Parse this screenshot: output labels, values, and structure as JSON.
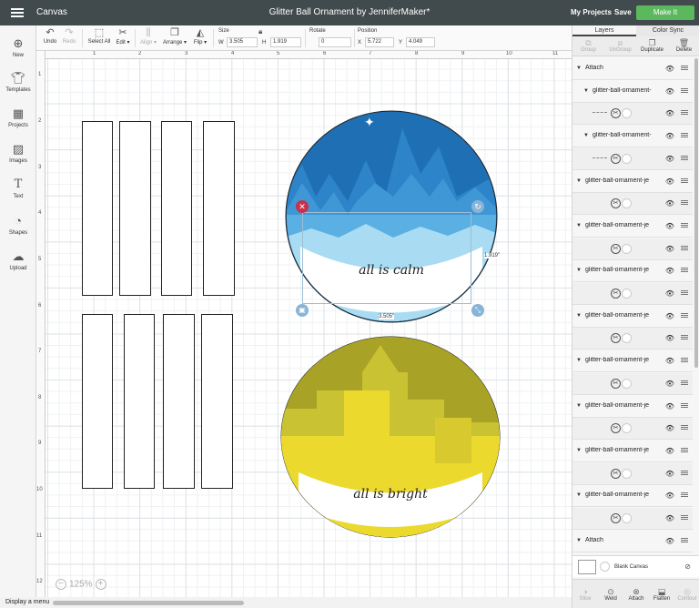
{
  "topbar": {
    "app_name": "Canvas",
    "doc_title": "Glitter Ball Ornament by JenniferMaker*",
    "my_projects": "My Projects",
    "save": "Save",
    "make_it": "Make It"
  },
  "toolbar": {
    "undo": "Undo",
    "redo": "Redo",
    "select_all": "Select All",
    "edit": "Edit",
    "align": "Align",
    "arrange": "Arrange",
    "flip": "Flip",
    "size_label": "Size",
    "w_label": "W",
    "w_value": "3.505",
    "h_label": "H",
    "h_value": "1.919",
    "rotate_label": "Rotate",
    "rotate_value": "0",
    "position_label": "Position",
    "x_label": "X",
    "x_value": "5.722",
    "y_label": "Y",
    "y_value": "4.049"
  },
  "sidebar": {
    "items": [
      {
        "label": "New",
        "icon": "plus-icon"
      },
      {
        "label": "Templates",
        "icon": "shirt-icon"
      },
      {
        "label": "Projects",
        "icon": "projects-icon"
      },
      {
        "label": "Images",
        "icon": "image-icon"
      },
      {
        "label": "Text",
        "icon": "text-icon"
      },
      {
        "label": "Shapes",
        "icon": "shapes-icon"
      },
      {
        "label": "Upload",
        "icon": "upload-icon"
      }
    ]
  },
  "canvas": {
    "ruler_top": [
      "1",
      "2",
      "3",
      "4",
      "5",
      "6",
      "7",
      "8",
      "9",
      "10",
      "11"
    ],
    "ruler_left": [
      "1",
      "2",
      "3",
      "4",
      "5",
      "6",
      "7",
      "8",
      "9",
      "10",
      "11",
      "12"
    ],
    "width_readout": "3.505\"",
    "height_readout": "1.919\"",
    "zoom": "125%",
    "ornament_top_text": "all is calm",
    "ornament_bottom_text": "all is bright",
    "colors": {
      "blue_dark": "#1f6fb5",
      "blue_mid": "#3f97d6",
      "blue_light": "#a9dcf2",
      "olive": "#a8a226",
      "olive_light": "#c9c232",
      "yellow": "#ecd92d"
    }
  },
  "status": {
    "text": "Display a menu"
  },
  "layers": {
    "tabs": [
      "Layers",
      "Color Sync"
    ],
    "actions": [
      "Group",
      "UnGroup",
      "Duplicate",
      "Delete"
    ],
    "rows": [
      {
        "type": "group",
        "name": "Attach",
        "indent": 0
      },
      {
        "type": "group",
        "name": "glitter-ball-ornament-",
        "indent": 1
      },
      {
        "type": "item",
        "thumb": true
      },
      {
        "type": "group",
        "name": "glitter-ball-ornament-",
        "indent": 1
      },
      {
        "type": "item",
        "thumb": true
      },
      {
        "type": "group",
        "name": "glitter-ball-ornament-je",
        "indent": 0
      },
      {
        "type": "item"
      },
      {
        "type": "group",
        "name": "glitter-ball-ornament-je",
        "indent": 0
      },
      {
        "type": "item"
      },
      {
        "type": "group",
        "name": "glitter-ball-ornament-je",
        "indent": 0
      },
      {
        "type": "item"
      },
      {
        "type": "group",
        "name": "glitter-ball-ornament-je",
        "indent": 0
      },
      {
        "type": "item"
      },
      {
        "type": "group",
        "name": "glitter-ball-ornament-je",
        "indent": 0
      },
      {
        "type": "item"
      },
      {
        "type": "group",
        "name": "glitter-ball-ornament-je",
        "indent": 0
      },
      {
        "type": "item"
      },
      {
        "type": "group",
        "name": "glitter-ball-ornament-je",
        "indent": 0
      },
      {
        "type": "item"
      },
      {
        "type": "group",
        "name": "glitter-ball-ornament-je",
        "indent": 0
      },
      {
        "type": "item"
      },
      {
        "type": "group",
        "name": "Attach",
        "indent": 0
      }
    ],
    "blank_canvas": "Blank Canvas",
    "footer_actions": [
      "Slice",
      "Weld",
      "Attach",
      "Flatten",
      "Contour"
    ]
  }
}
